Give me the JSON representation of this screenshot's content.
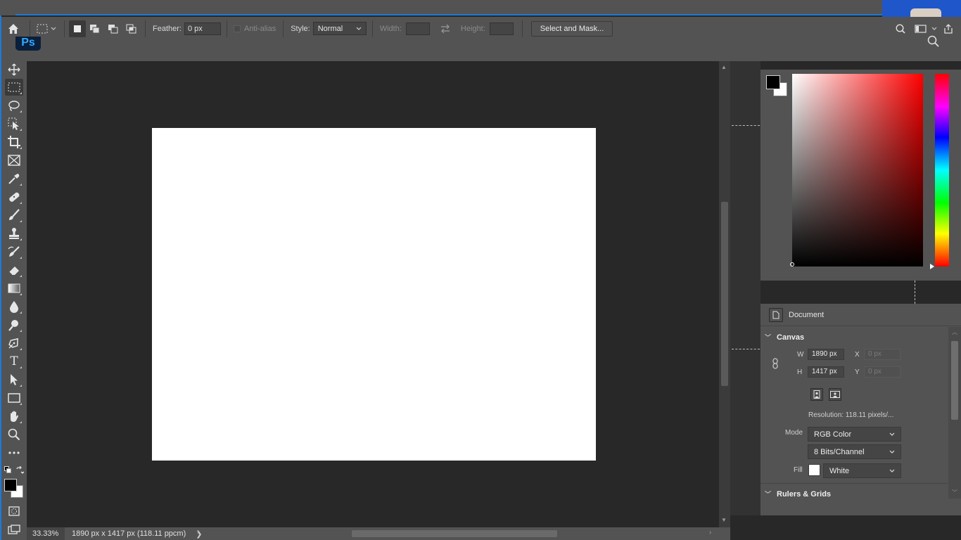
{
  "options_bar": {
    "feather_label": "Feather:",
    "feather_value": "0 px",
    "antialias_label": "Anti-alias",
    "style_label": "Style:",
    "style_value": "Normal",
    "width_label": "Width:",
    "height_label": "Height:",
    "select_mask_label": "Select and Mask..."
  },
  "logo": {
    "text": "Ps"
  },
  "toolbox": {
    "tools": [
      "move-tool",
      "rectangular-marquee-tool",
      "lasso-tool",
      "object-selection-tool",
      "crop-tool",
      "frame-tool",
      "eyedropper-tool",
      "healing-brush-tool",
      "brush-tool",
      "clone-stamp-tool",
      "history-brush-tool",
      "eraser-tool",
      "gradient-tool",
      "blur-tool",
      "dodge-tool",
      "pen-tool",
      "type-tool",
      "path-selection-tool",
      "rectangle-tool",
      "hand-tool",
      "zoom-tool",
      "more-tools"
    ],
    "active_tool": "rectangular-marquee-tool",
    "type_glyph": "T",
    "foreground_color": "#000000",
    "background_color": "#ffffff"
  },
  "status_bar": {
    "zoom": "33.33%",
    "doc_info": "1890 px x 1417 px (118.11 ppcm)"
  },
  "color_picker": {
    "foreground": "#000000",
    "background": "#ffffff",
    "hue": "#ff0000"
  },
  "properties": {
    "header": "Document",
    "canvas_section": "Canvas",
    "w_label": "W",
    "w_value": "1890 px",
    "h_label": "H",
    "h_value": "1417 px",
    "x_label": "X",
    "x_value": "0 px",
    "y_label": "Y",
    "y_value": "0 px",
    "resolution": "Resolution:  118.11  pixels/...",
    "mode_label": "Mode",
    "mode_value": "RGB Color",
    "bits_value": "8 Bits/Channel",
    "fill_label": "Fill",
    "fill_value": "White",
    "fill_color": "#ffffff",
    "rulers_section": "Rulers & Grids"
  }
}
